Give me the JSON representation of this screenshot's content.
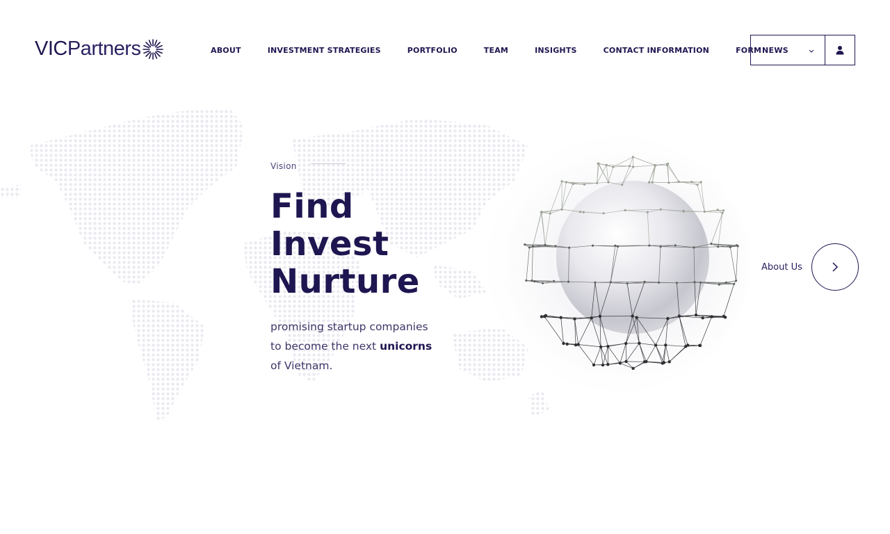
{
  "brand": {
    "name_part1": "VIC",
    "name_part2": "Partners",
    "color": "#1e1650"
  },
  "nav": {
    "items": [
      {
        "label": "ABOUT"
      },
      {
        "label": "INVESTMENT STRATEGIES"
      },
      {
        "label": "PORTFOLIO"
      },
      {
        "label": "TEAM"
      },
      {
        "label": "INSIGHTS"
      },
      {
        "label": "CONTACT INFORMATION"
      },
      {
        "label": "FORM"
      }
    ]
  },
  "header": {
    "news_select": {
      "value": "NEWS",
      "icon": "chevron-down-icon"
    },
    "user_button": {
      "icon": "user-icon"
    }
  },
  "hero": {
    "eyebrow": "Vision",
    "headline": [
      "Find",
      "Invest",
      "Nurture"
    ],
    "tagline": {
      "line1": "promising startup companies",
      "line2_prefix": "to become the next ",
      "line2_emphasis": "unicorns",
      "line3": "of Vietnam."
    }
  },
  "about_link": {
    "label": "About Us",
    "icon": "chevron-right-icon"
  },
  "colors": {
    "accent": "#1e1650",
    "text_muted": "#4a4378",
    "map_dots": "#eceaf1"
  }
}
